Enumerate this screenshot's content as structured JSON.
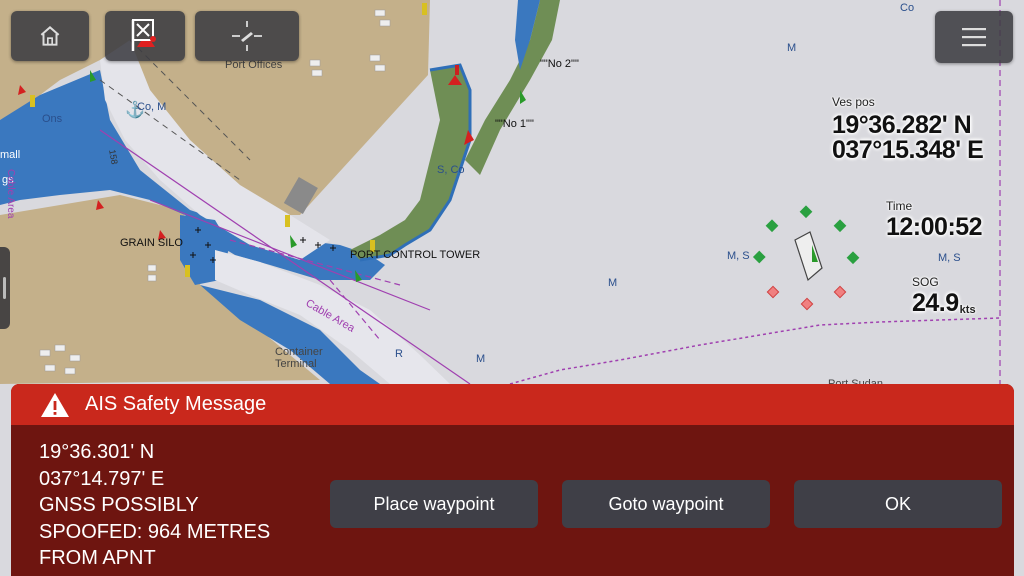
{
  "toolbar": {
    "home_icon": "home-icon",
    "mob_icon": "man-overboard-flag-icon",
    "waypoint_icon": "waypoint-crosshair-icon",
    "menu_icon": "hamburger-menu-icon"
  },
  "chart_labels": {
    "port_offices": "Port Offices",
    "grain_silo": "GRAIN SILO",
    "port_control_tower": "PORT CONTROL TOWER",
    "cable_area": "Cable Area",
    "cable_area_left": "Cable Area",
    "container_terminal_1": "Container",
    "container_terminal_2": "Terminal",
    "port_sudan": "Port Sudan",
    "no2": "\"\"No 2\"\"",
    "no1": "\"\"No 1\"\"",
    "s_co": "S, Co",
    "co_m": "Co, M",
    "co_top": "Co",
    "m_top": "M",
    "m_s_left": "M, S",
    "m_s_right": "M, S",
    "m_mid": "M",
    "m_bottom": "M",
    "r": "R",
    "ons": "Ons",
    "mall": "mall",
    "gs": "gs",
    "s_small": "S",
    "depth_158": "158"
  },
  "readouts": {
    "ves_pos_label": "Ves pos",
    "lat": "19°36.282' N",
    "lon": "037°15.348' E",
    "time_label": "Time",
    "time": "12:00:52",
    "sog_label": "SOG",
    "sog_value": "24.9",
    "sog_unit": "kts"
  },
  "dialog": {
    "icon": "warning-triangle-icon",
    "title": "AIS Safety Message",
    "lines": [
      "19°36.301' N",
      "037°14.797' E",
      "GNSS POSSIBLY",
      "SPOOFED: 964 METRES",
      "FROM APNT"
    ],
    "buttons": {
      "place_waypoint": "Place waypoint",
      "goto_waypoint": "Goto waypoint",
      "ok": "OK"
    }
  },
  "colors": {
    "land": "#c7b38a",
    "shallow": "#2f6fb8",
    "deep": "#d6d6dc",
    "intertidal": "#6f8e55",
    "alert_header": "#c9281c",
    "alert_body": "#6e1510",
    "button": "#3f3f47"
  }
}
